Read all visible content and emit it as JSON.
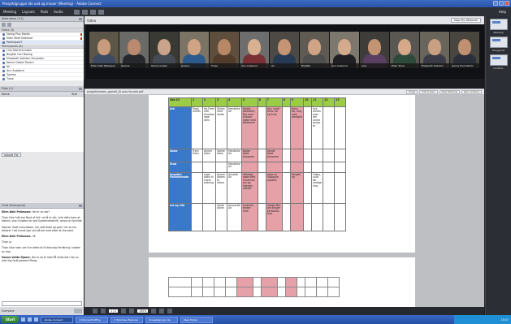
{
  "window": {
    "title": "Prosjektgruppe ide uod og mooer (Meeting) - Adobe Connect"
  },
  "menu": {
    "items": [
      "Meeting",
      "Layouts",
      "Pods",
      "Audio"
    ],
    "help": "Help"
  },
  "attendees": {
    "title": "Attendees (11)",
    "hosts_label": "Hosts (3)",
    "hosts": [
      "Georg Plus Martin",
      "Ellen Shell Dekland",
      "Participant?"
    ],
    "participants_label": "Participants (8)",
    "participants": [
      "Lina Stenersrusten",
      "Birgitte Carl Rasing",
      "Elisabeth Solheim Ferporten",
      "Kenne Gobini Tovern",
      "Ali",
      "Ann Auskand",
      "Gaerse",
      "Tinse"
    ]
  },
  "notes": {
    "title": "Files (1)",
    "col_name": "Name",
    "col_size": "Size",
    "upload": "Upload File"
  },
  "chat": {
    "title": "Chat  (Everyone)",
    "messages": [
      {
        "who": "Ellen Dekl Pellessen:",
        "text": "Hei er du der?"
      },
      {
        "who": "",
        "text": "Tinje: Ikke fullt avs Bord of fult i at tå ut vår, Lele deltv bare at klarenl, vise til jobbe for ved Syskehushelvilk, nanne or fynkilde"
      },
      {
        "who": "",
        "text": "Gaerse: Godt kvmyldsom, har sett blabl og gavt i far se her foklarer I att kunne lige vell på bel med etter at the samt"
      },
      {
        "who": "Ellen Dekl Pellessen:",
        "text": "OK"
      },
      {
        "who": "",
        "text": "Tinje: ja"
      },
      {
        "who": "",
        "text": "Tinje: Ikke noen vet Hun delte at til dokuntg Ferdilning I sladen av vise"
      },
      {
        "who": "Hanne Vahte Gjoem:",
        "text": "Hei er ha til Irdal På enlke bid i tek av alle ting forkhyorderd Pleeg."
      }
    ],
    "footer_label": "Everyone"
  },
  "video": {
    "title": "Video",
    "stop_button": "Stop My Webcam",
    "tiles": [
      {
        "name": "Ellen Dekl Pellessen",
        "face": "#c79b7c",
        "shirt": "#3d4a62",
        "bg": "#5b5648"
      },
      {
        "name": "Gaerse",
        "face": "#b98a6e",
        "shirt": "#26282d",
        "bg": "#6a6a66"
      },
      {
        "name": "Henok Gobini",
        "face": "#caa48a",
        "shirt": "#444b55",
        "bg": "#3a3a35"
      },
      {
        "name": "Gwenn",
        "face": "#d0a384",
        "shirt": "#2d5a8c",
        "bg": "#7b7364"
      },
      {
        "name": "Tinse",
        "face": "#b88866",
        "shirt": "#513c2c",
        "bg": "#5d4e3e"
      },
      {
        "name": "Ann Auskand",
        "face": "#d9b190",
        "shirt": "#7a2f35",
        "bg": "#6d6d6d"
      },
      {
        "name": "Ali",
        "face": "#c49474",
        "shirt": "#263a55",
        "bg": "#4d4a45"
      },
      {
        "name": "Birgitte",
        "face": "#cfa383",
        "shirt": "#4e4e4e",
        "bg": "#5f5a52"
      },
      {
        "name": "Ann Auskand",
        "face": "#d3ab8c",
        "shirt": "#1f1f24",
        "bg": "#7d786e"
      },
      {
        "name": "Lina",
        "face": "#c39472",
        "shirt": "#5a3f63",
        "bg": "#3f3d3a"
      },
      {
        "name": "Ellen Shell",
        "face": "#d5a98a",
        "shirt": "#2e4a3a",
        "bg": "#5a5752"
      },
      {
        "name": "Elisabeth Solheim",
        "face": "#c8a081",
        "shirt": "#3b3b48",
        "bg": "#6a655b"
      },
      {
        "name": "Georg Plus Martin",
        "face": "#bf9072",
        "shirt": "#2a2f3a",
        "bg": "#48463f"
      }
    ]
  },
  "document": {
    "title": "prosjektmalen_ganett_til-ulov-for.adv.pdf",
    "buttons": [
      "Draw",
      "Full Screen",
      "Stop Sharing",
      "Sync Actions"
    ],
    "page": "1 / 2",
    "zoom": "100%"
  },
  "table": {
    "header": [
      "Uke 43",
      "1",
      "2",
      "3",
      "4",
      "5",
      "6",
      "7",
      "8",
      "9",
      "10",
      "11",
      "12",
      "13"
    ],
    "rows": [
      {
        "label": "Ark",
        "cells": [
          "Prosj. ments",
          "Ha Frem mål, Hvordan lage dem",
          "Skrive med Sorbe",
          "Hendelse Ari",
          "Første kontakter, Bra med Ansvarl. møte med Medlemm",
          "",
          "Ara, vurd/ Ansv. for hg bruk",
          "",
          "Hans lav, ting med vanlighti",
          "",
          "Ara, omres mot del andre grupp er",
          "",
          ""
        ]
      },
      {
        "label": "Skole",
        "cells": [
          "Frem tillen",
          "Annen tiden",
          "Samle tiden",
          "Hendelse Ari",
          "Bedre fatet Ansvaren",
          "",
          "Sende fatet Ansvaren",
          "",
          "",
          "",
          "",
          "",
          ""
        ]
      },
      {
        "label": "Stud",
        "cells": [
          "",
          "",
          "",
          "Hendelse Ari",
          "",
          "",
          "",
          "",
          "",
          "",
          "",
          "",
          ""
        ]
      },
      {
        "label": "Ansatte/ Veiledermøte",
        "cells": [
          "",
          "Lage tiden til intern ordning",
          "Annen tidden til intern",
          "Ansatte Ari",
          "Veiledet, møte Med Studenter om og intensiv veiledt",
          "",
          "Lage en Oppgave oppsett",
          "",
          "Ferigeli hg",
          "",
          "Fokus, slutt før endige ring",
          "",
          ""
        ]
      },
      {
        "label": "Lei og elld",
        "cells": [
          "",
          "",
          "Spate plane",
          "Ansvarlet Ari",
          "Innenvill endne intre",
          "",
          "Studie Mer om Bruger på Kontor. mgr",
          "",
          "",
          "",
          "",
          "",
          ""
        ]
      }
    ],
    "pink_cols": [
      5,
      7,
      9
    ]
  },
  "rightbar": {
    "items": [
      "Meeting",
      "Hengende",
      "Lootbox"
    ]
  },
  "taskbar": {
    "start": "Start",
    "tasks": [
      "Adobe Connect",
      "2 Microsoft Office",
      "2 Windows Explorer",
      "Prosjektgrupp ide",
      "New Folder"
    ],
    "clock": "13:47"
  }
}
